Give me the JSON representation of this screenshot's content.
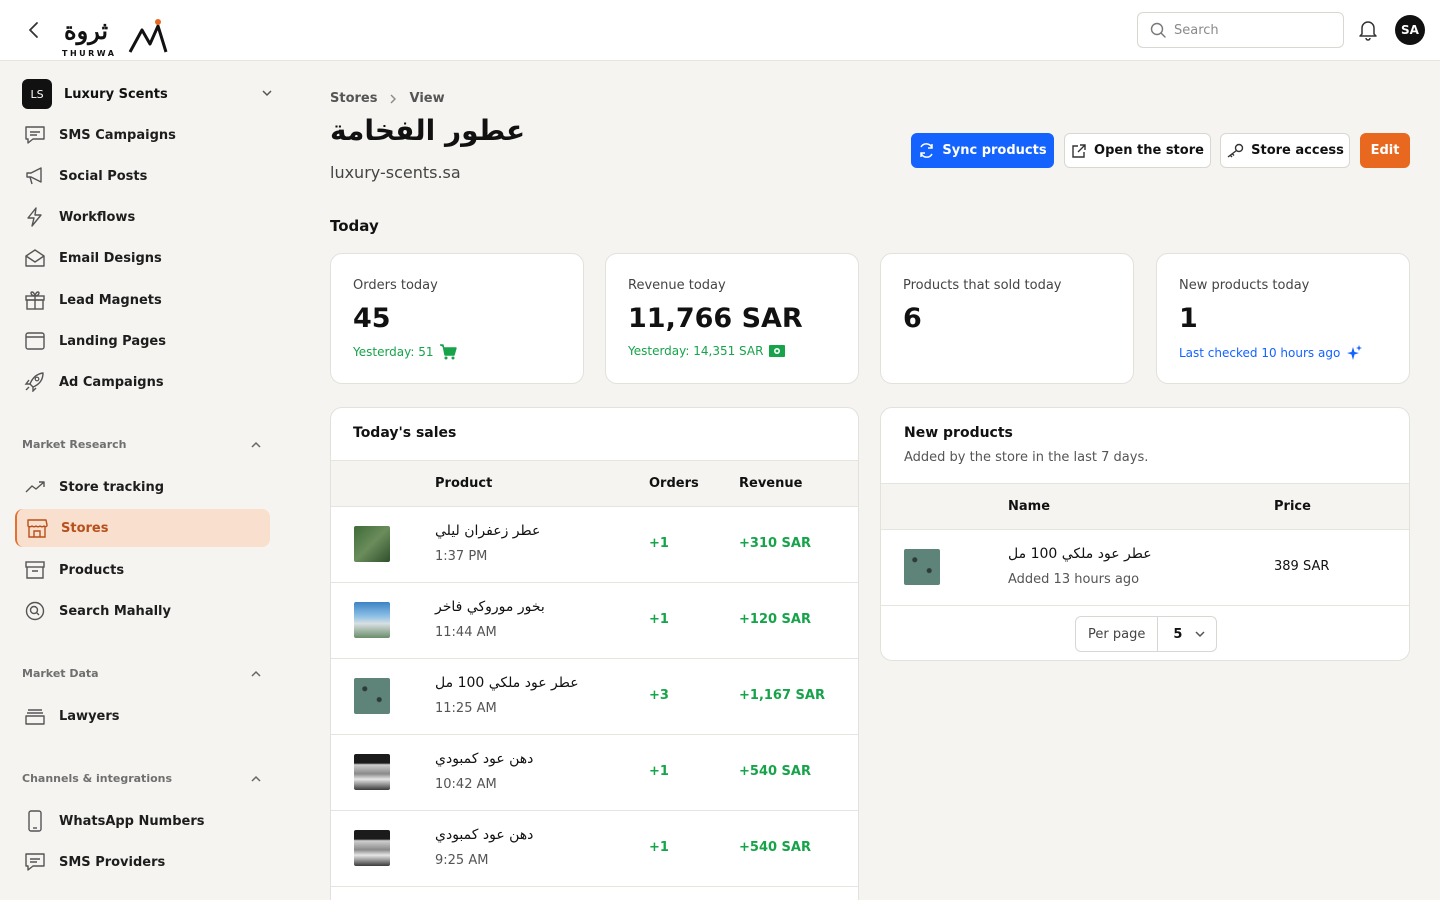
{
  "header": {
    "logo_ar": "ثروة",
    "logo_en": "THURWA",
    "search_placeholder": "Search",
    "avatar_initials": "SA"
  },
  "workspace": {
    "badge": "LS",
    "name": "Luxury Scents"
  },
  "sidebar": {
    "items": [
      {
        "label": "SMS Campaigns",
        "icon": "message-icon"
      },
      {
        "label": "Social Posts",
        "icon": "megaphone-icon"
      },
      {
        "label": "Workflows",
        "icon": "bolt-icon"
      },
      {
        "label": "Email Designs",
        "icon": "envelope-icon"
      },
      {
        "label": "Lead Magnets",
        "icon": "gift-icon"
      },
      {
        "label": "Landing Pages",
        "icon": "browser-icon"
      },
      {
        "label": "Ad Campaigns",
        "icon": "rocket-icon"
      }
    ],
    "market_research": {
      "title": "Market Research",
      "items": [
        {
          "label": "Store tracking",
          "icon": "trend-icon"
        },
        {
          "label": "Stores",
          "icon": "store-icon",
          "active": true
        },
        {
          "label": "Products",
          "icon": "archive-icon"
        },
        {
          "label": "Search Mahally",
          "icon": "search-circle-icon"
        }
      ]
    },
    "market_data": {
      "title": "Market Data",
      "items": [
        {
          "label": "Lawyers",
          "icon": "folder-icon"
        }
      ]
    },
    "channels": {
      "title": "Channels & integrations",
      "items": [
        {
          "label": "WhatsApp Numbers",
          "icon": "phone-icon"
        },
        {
          "label": "SMS Providers",
          "icon": "message-icon"
        }
      ]
    }
  },
  "breadcrumb": {
    "first": "Stores",
    "second": "View"
  },
  "store": {
    "title": "عطور الفخامة",
    "domain": "luxury-scents.sa"
  },
  "actions": {
    "sync": "Sync products",
    "open": "Open the store",
    "access": "Store access",
    "edit": "Edit"
  },
  "today_heading": "Today",
  "stats": {
    "orders": {
      "label": "Orders today",
      "value": "45",
      "sub": "Yesterday: 51"
    },
    "revenue": {
      "label": "Revenue today",
      "value": "11,766 SAR",
      "sub": "Yesterday: 14,351 SAR"
    },
    "sold": {
      "label": "Products that sold today",
      "value": "6"
    },
    "new": {
      "label": "New products today",
      "value": "1",
      "sub": "Last checked 10 hours ago"
    }
  },
  "sales": {
    "title": "Today's sales",
    "columns": {
      "product": "Product",
      "orders": "Orders",
      "revenue": "Revenue"
    },
    "rows": [
      {
        "name": "عطر زعفران ليلي",
        "time": "1:37 PM",
        "orders": "+1",
        "revenue": "+310 SAR"
      },
      {
        "name": "بخور موروكي فاخر",
        "time": "11:44 AM",
        "orders": "+1",
        "revenue": "+120 SAR"
      },
      {
        "name": "عطر عود ملكي 100 مل",
        "time": "11:25 AM",
        "orders": "+3",
        "revenue": "+1,167 SAR"
      },
      {
        "name": "دهن عود كمبودي",
        "time": "10:42 AM",
        "orders": "+1",
        "revenue": "+540 SAR"
      },
      {
        "name": "دهن عود كمبودي",
        "time": "9:25 AM",
        "orders": "+1",
        "revenue": "+540 SAR"
      }
    ]
  },
  "new_products": {
    "title": "New products",
    "subtitle": "Added by the store in the last 7 days.",
    "columns": {
      "name": "Name",
      "price": "Price"
    },
    "rows": [
      {
        "name": "عطر عود ملكي 100 مل",
        "added": "Added 13 hours ago",
        "price": "389 SAR"
      }
    ],
    "per_page_label": "Per page",
    "per_page_value": "5"
  },
  "colors": {
    "primary": "#1463ff",
    "accent": "#e8681f",
    "success": "#16a34a",
    "active_bg": "#f8dfce"
  }
}
